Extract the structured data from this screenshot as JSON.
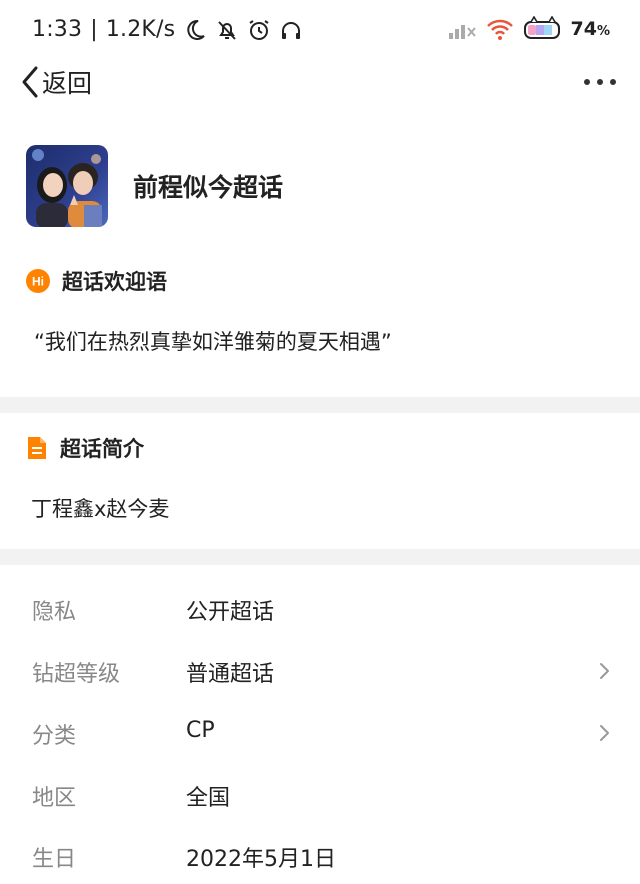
{
  "status_bar": {
    "time": "1:33",
    "speed": "1.2K/s",
    "battery_value": "74",
    "battery_unit": "%",
    "icons": [
      "moon-icon",
      "bell-off-icon",
      "alarm-icon",
      "headphones-icon",
      "signal-icon",
      "wifi-icon",
      "battery-icon"
    ]
  },
  "nav": {
    "back_label": "返回",
    "more_icon": "more-icon"
  },
  "topic": {
    "title": "前程似今超话"
  },
  "welcome_section": {
    "title": "超话欢迎语",
    "text": "“我们在热烈真挚如洋雏菊的夏天相遇”",
    "icon": "hi-icon"
  },
  "intro_section": {
    "title": "超话简介",
    "text": "丁程鑫x赵今麦",
    "icon": "document-icon"
  },
  "info": [
    {
      "label": "隐私",
      "value": "公开超话",
      "chevron": false
    },
    {
      "label": "钻超等级",
      "value": "普通超话",
      "chevron": true
    },
    {
      "label": "分类",
      "value": "CP",
      "chevron": true
    },
    {
      "label": "地区",
      "value": "全国",
      "chevron": false
    },
    {
      "label": "生日",
      "value": "2022年5月1日",
      "chevron": false
    }
  ],
  "colors": {
    "accent": "#ff8200",
    "divider": "#f2f2f2",
    "label_gray": "#888888"
  }
}
